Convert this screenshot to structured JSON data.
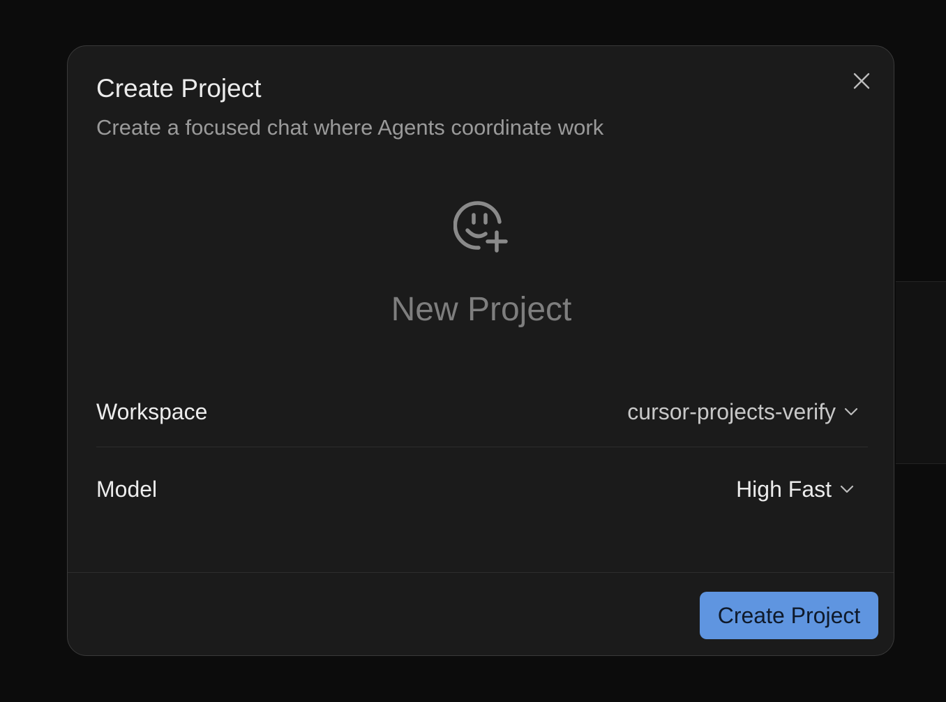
{
  "dialog": {
    "title": "Create Project",
    "subtitle": "Create a focused chat where Agents coordinate work",
    "close_icon": "close-icon"
  },
  "hero": {
    "icon": "smiley-plus-icon",
    "project_name": "New Project"
  },
  "fields": {
    "workspace": {
      "label": "Workspace",
      "value": "cursor-projects-verify",
      "icon": "chevron-down-icon"
    },
    "model": {
      "label": "Model",
      "value": "High Fast",
      "icon": "chevron-down-icon"
    }
  },
  "footer": {
    "create_label": "Create Project"
  },
  "colors": {
    "accent": "#5f95e0",
    "modal_bg": "#1b1b1b",
    "page_bg": "#0c0c0c"
  }
}
